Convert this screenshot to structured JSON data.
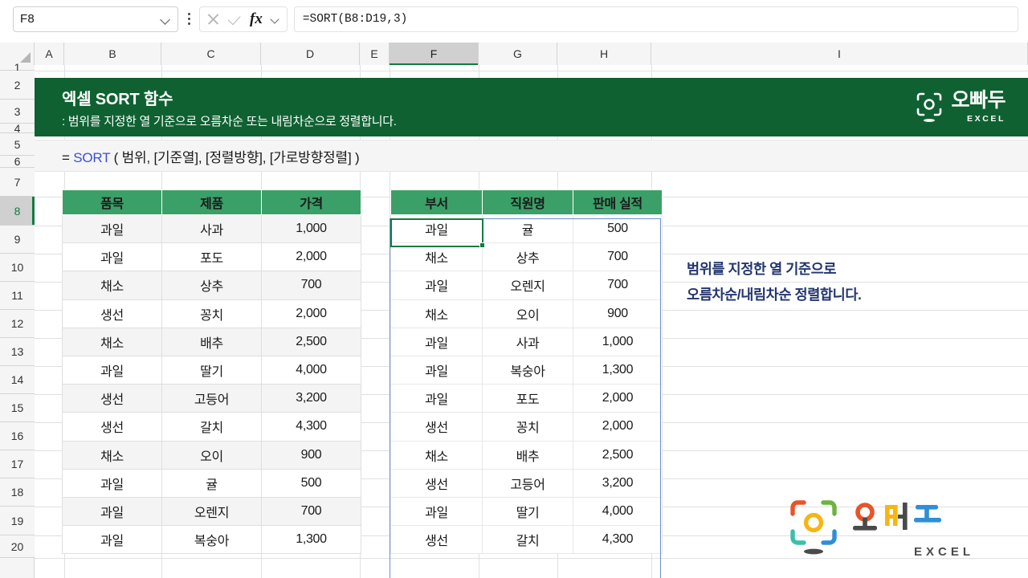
{
  "formula_bar": {
    "name_box_value": "F8",
    "formula_value": "=SORT(B8:D19,3)",
    "cancel_icon": "close-x-icon",
    "enter_icon": "checkmark-icon",
    "function_icon": "fx-insert-function-icon",
    "dropdown_icon": "chevron-down-icon",
    "more_icon": "kebab-menu-icon"
  },
  "grid": {
    "column_headers": [
      "A",
      "B",
      "C",
      "D",
      "E",
      "F",
      "G",
      "H",
      "I"
    ],
    "selected_column": "F",
    "row_headers": [
      "1",
      "2",
      "3",
      "4",
      "5",
      "6",
      "7",
      "8",
      "9",
      "10",
      "11",
      "12",
      "13",
      "14",
      "15",
      "16",
      "17",
      "18",
      "19",
      "20"
    ],
    "selected_row": "8"
  },
  "banner": {
    "title": "엑셀 SORT 함수",
    "subtitle": ": 범위를 지정한 열 기준으로 오름차순 또는 내림차순으로 정렬합니다.",
    "bg_color": "#0f6132"
  },
  "syntax": {
    "prefix": "= ",
    "function_name": "SORT",
    "args": " ( 범위, [기준열], [정렬방향], [가로방향정렬] )",
    "function_color": "#3a4fd8"
  },
  "logo_top": {
    "wordmark": "오빠두",
    "subtext": "EXCEL",
    "icon": "camera-bracket-icon"
  },
  "logo_watermark": {
    "wordmark": "오빠두",
    "subtext": "EXCEL",
    "icon": "camera-bracket-icon",
    "colors": {
      "top_left": "#e8542a",
      "top_right": "#6cb33f",
      "bottom_left": "#3bbfad",
      "bottom_right": "#2f8fd6",
      "center_ring": "#f5b615",
      "text_o": "#e8542a",
      "text_ppa": "#f5b615",
      "text_du": "#2f8fd6",
      "text_dark": "#4a4a4a"
    }
  },
  "table_source": {
    "headers": [
      "품목",
      "제품",
      "가격"
    ],
    "rows": [
      [
        "과일",
        "사과",
        "1,000"
      ],
      [
        "과일",
        "포도",
        "2,000"
      ],
      [
        "채소",
        "상추",
        "700"
      ],
      [
        "생선",
        "꽁치",
        "2,000"
      ],
      [
        "채소",
        "배추",
        "2,500"
      ],
      [
        "과일",
        "딸기",
        "4,000"
      ],
      [
        "생선",
        "고등어",
        "3,200"
      ],
      [
        "생선",
        "갈치",
        "4,300"
      ],
      [
        "채소",
        "오이",
        "900"
      ],
      [
        "과일",
        "귤",
        "500"
      ],
      [
        "과일",
        "오렌지",
        "700"
      ],
      [
        "과일",
        "복숭아",
        "1,300"
      ]
    ]
  },
  "table_result": {
    "headers": [
      "부서",
      "직원명",
      "판매 실적"
    ],
    "rows": [
      [
        "과일",
        "귤",
        "500"
      ],
      [
        "채소",
        "상추",
        "700"
      ],
      [
        "과일",
        "오렌지",
        "700"
      ],
      [
        "채소",
        "오이",
        "900"
      ],
      [
        "과일",
        "사과",
        "1,000"
      ],
      [
        "과일",
        "복숭아",
        "1,300"
      ],
      [
        "과일",
        "포도",
        "2,000"
      ],
      [
        "생선",
        "꽁치",
        "2,000"
      ],
      [
        "채소",
        "배추",
        "2,500"
      ],
      [
        "생선",
        "고등어",
        "3,200"
      ],
      [
        "과일",
        "딸기",
        "4,000"
      ],
      [
        "생선",
        "갈치",
        "4,300"
      ]
    ]
  },
  "annotation": {
    "line1": "범위를 지정한 열 기준으로",
    "line2": "오름차순/내림차순 정렬합니다.",
    "color": "#22356e"
  },
  "theme": {
    "header_green": "#3aa068",
    "banner_green": "#0f6132",
    "excel_green": "#107c41",
    "spill_blue": "#6b8fc7"
  }
}
